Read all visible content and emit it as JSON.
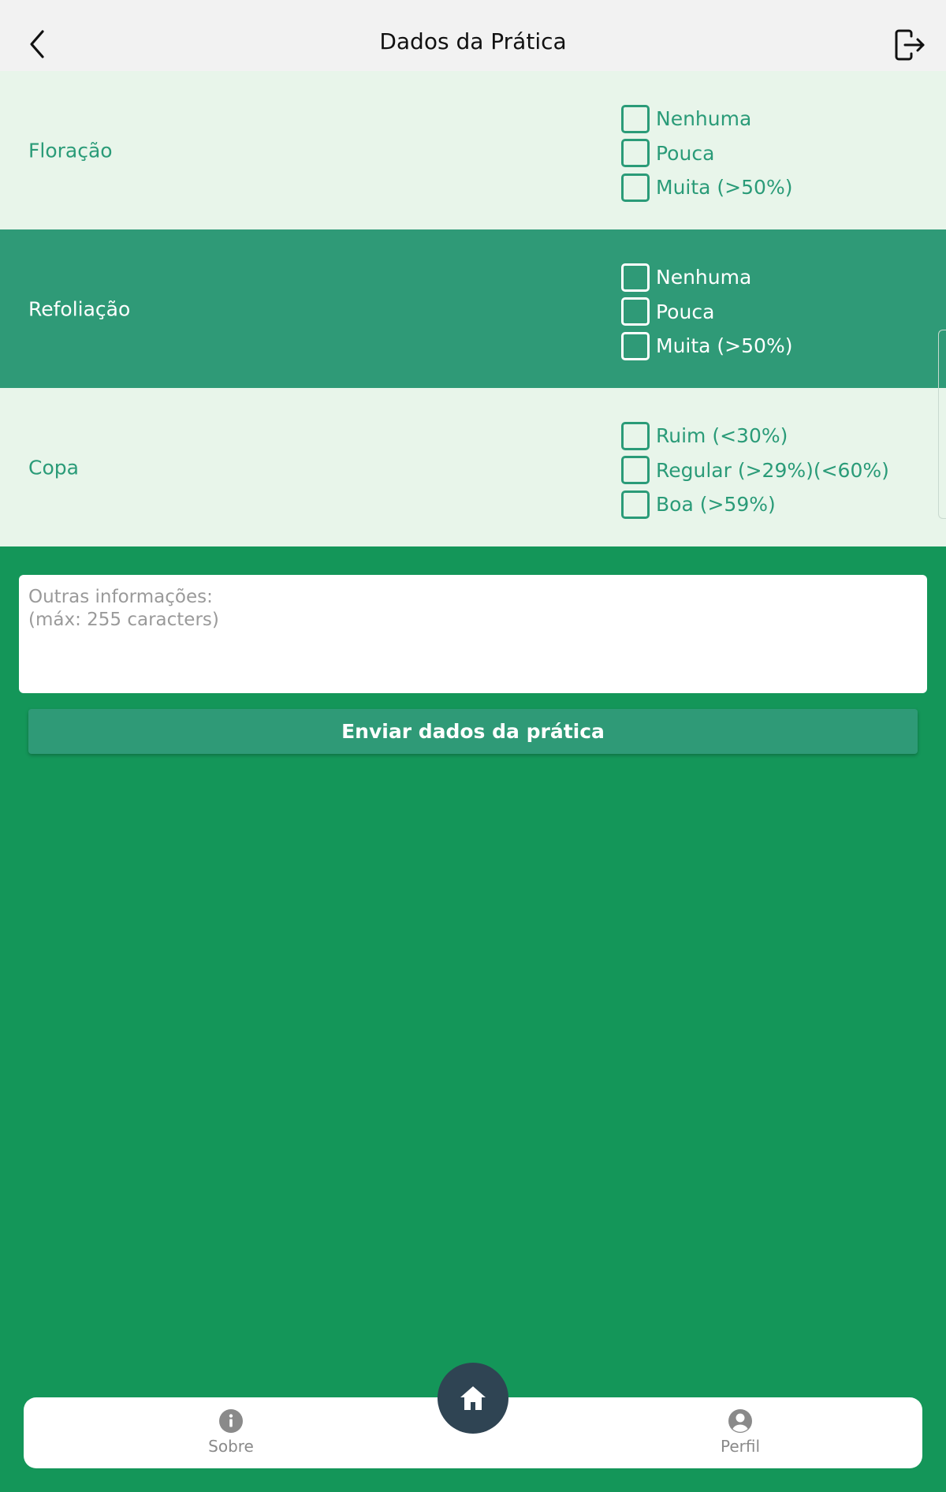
{
  "header": {
    "title": "Dados da Prática"
  },
  "sections": [
    {
      "label": "Floração",
      "options": [
        "Nenhuma",
        "Pouca",
        "Muita (>50%)"
      ]
    },
    {
      "label": "Refoliação",
      "options": [
        "Nenhuma",
        "Pouca",
        "Muita (>50%)"
      ]
    },
    {
      "label": "Copa",
      "options": [
        "Ruim (<30%)",
        "Regular (>29%)(<60%)",
        "Boa (>59%)"
      ]
    }
  ],
  "notes": {
    "placeholder": "Outras informações:\n(máx: 255 caracters)",
    "value": ""
  },
  "submit": {
    "label": "Enviar dados da prática"
  },
  "nav": {
    "about": {
      "label": "Sobre",
      "icon": "info-icon"
    },
    "home": {
      "icon": "home-icon"
    },
    "profile": {
      "label": "Perfil",
      "icon": "user-icon"
    }
  },
  "colors": {
    "background": "#149659",
    "section_light": "#e8f5ea",
    "section_dark": "#2f9a77",
    "accent_text": "#2a9b78",
    "home_button": "#2f4453"
  }
}
